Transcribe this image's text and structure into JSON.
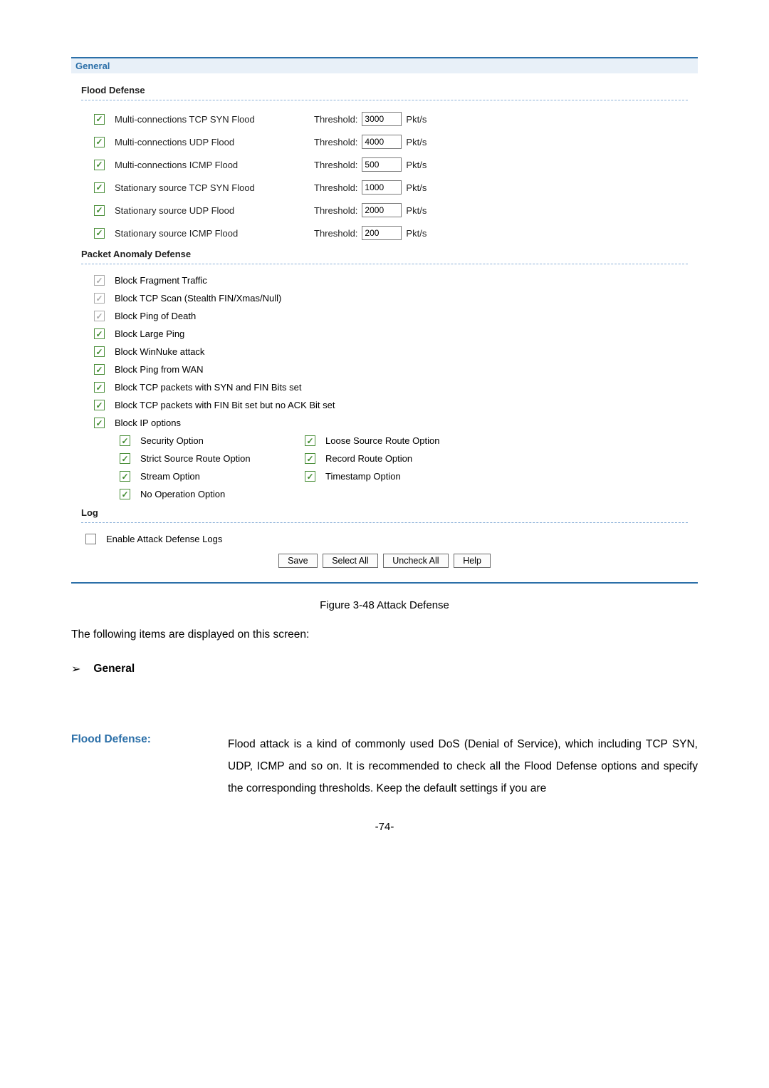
{
  "panel": {
    "general_label": "General",
    "flood_defense_title": "Flood Defense",
    "packet_anomaly_title": "Packet Anomaly Defense",
    "log_title": "Log",
    "threshold_label": "Threshold:",
    "unit": "Pkt/s",
    "flood_rows": [
      {
        "label": "Multi-connections TCP SYN Flood",
        "value": "3000"
      },
      {
        "label": "Multi-connections UDP Flood",
        "value": "4000"
      },
      {
        "label": "Multi-connections ICMP Flood",
        "value": "500"
      },
      {
        "label": "Stationary source TCP SYN Flood",
        "value": "1000"
      },
      {
        "label": "Stationary source UDP Flood",
        "value": "2000"
      },
      {
        "label": "Stationary source ICMP Flood",
        "value": "200"
      }
    ],
    "pa_rows": [
      {
        "label": "Block Fragment Traffic",
        "disabled": true
      },
      {
        "label": "Block TCP Scan (Stealth FIN/Xmas/Null)",
        "disabled": true
      },
      {
        "label": "Block Ping of Death",
        "disabled": true
      },
      {
        "label": "Block Large Ping",
        "disabled": false
      },
      {
        "label": "Block WinNuke attack",
        "disabled": false
      },
      {
        "label": "Block Ping from WAN",
        "disabled": false
      },
      {
        "label": "Block TCP packets with SYN and FIN Bits set",
        "disabled": false
      },
      {
        "label": "Block TCP packets with FIN Bit set but no ACK Bit set",
        "disabled": false
      },
      {
        "label": "Block IP options",
        "disabled": false
      }
    ],
    "ip_options": {
      "security": "Security Option",
      "loose_source": "Loose Source Route Option",
      "strict_source": "Strict Source Route Option",
      "record_route": "Record Route Option",
      "stream": "Stream Option",
      "timestamp": "Timestamp Option",
      "no_op": "No Operation Option"
    },
    "log_label": "Enable Attack Defense Logs",
    "buttons": {
      "save": "Save",
      "select_all": "Select All",
      "uncheck_all": "Uncheck All",
      "help": "Help"
    }
  },
  "caption": "Figure 3-48 Attack Defense",
  "intro": "The following items are displayed on this screen:",
  "bullet": "General",
  "desc": {
    "term": "Flood Defense:",
    "text": "Flood attack is a kind of commonly used DoS (Denial of Service), which including TCP SYN, UDP, ICMP and so on. It is recommended to check all the Flood Defense options and specify the corresponding thresholds. Keep the default settings if you are"
  },
  "pagenum": "-74-"
}
